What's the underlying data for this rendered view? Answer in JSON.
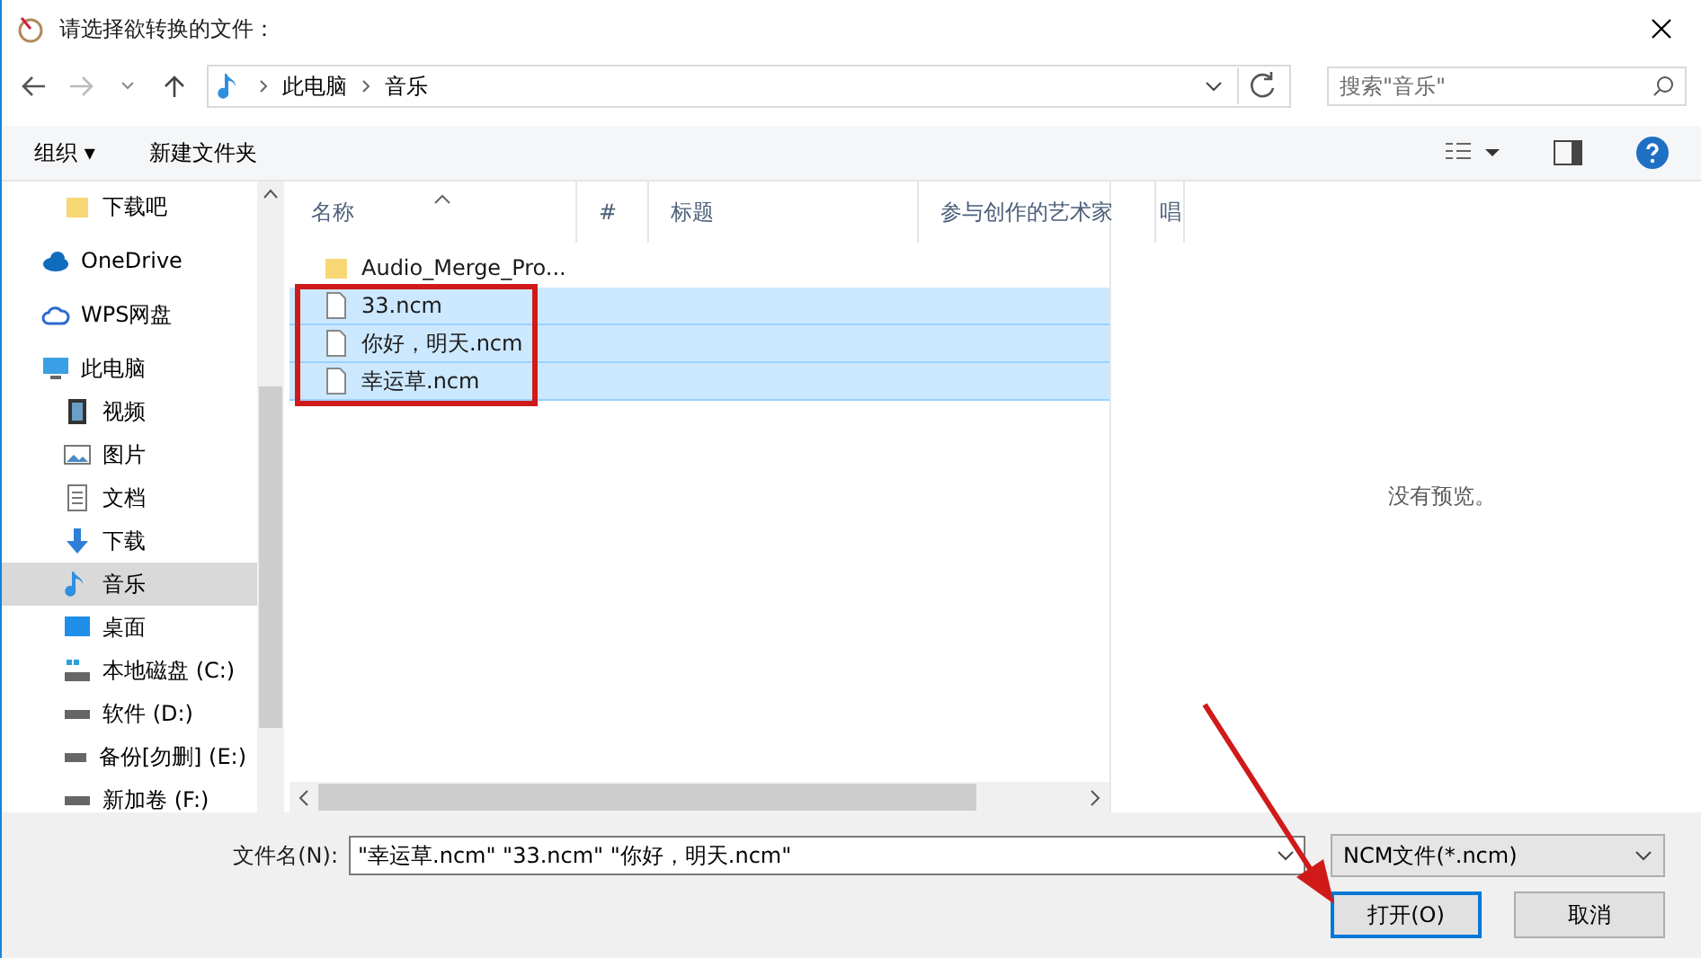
{
  "window": {
    "title": "请选择欲转换的文件："
  },
  "address": {
    "crumbs": [
      "此电脑",
      "音乐"
    ],
    "search_placeholder": "搜索\"音乐\""
  },
  "commands": {
    "organize": "组织 ▾",
    "new_folder": "新建文件夹"
  },
  "sidebar": {
    "pinned": [
      {
        "label": "下载吧",
        "selected": false
      }
    ],
    "items": [
      {
        "label": "OneDrive",
        "selected": false
      },
      {
        "label": "WPS网盘",
        "selected": false
      },
      {
        "label": "此电脑",
        "selected": false,
        "children": [
          {
            "label": "视频",
            "selected": false
          },
          {
            "label": "图片",
            "selected": false
          },
          {
            "label": "文档",
            "selected": false
          },
          {
            "label": "下载",
            "selected": false
          },
          {
            "label": "音乐",
            "selected": true
          },
          {
            "label": "桌面",
            "selected": false
          },
          {
            "label": "本地磁盘 (C:)",
            "selected": false
          },
          {
            "label": "软件 (D:)",
            "selected": false
          },
          {
            "label": "备份[勿删] (E:)",
            "selected": false
          },
          {
            "label": "新加卷 (F:)",
            "selected": false
          }
        ]
      }
    ]
  },
  "table": {
    "columns": [
      "名称",
      "#",
      "标题",
      "参与创作的艺术家",
      "唱"
    ],
    "rows": [
      {
        "name": "Audio_Merge_Pro...",
        "kind": "folder",
        "selected": false
      },
      {
        "name": "33.ncm",
        "kind": "file",
        "selected": true
      },
      {
        "name": "你好，明天.ncm",
        "kind": "file",
        "selected": true
      },
      {
        "name": "幸运草.ncm",
        "kind": "file",
        "selected": true
      }
    ]
  },
  "preview": {
    "message": "没有预览。"
  },
  "footer": {
    "filename_label": "文件名(N):",
    "filename_value": "\"幸运草.ncm\" \"33.ncm\" \"你好，明天.ncm\"",
    "filter": "NCM文件(*.ncm)",
    "open": "打开(O)",
    "cancel": "取消"
  }
}
